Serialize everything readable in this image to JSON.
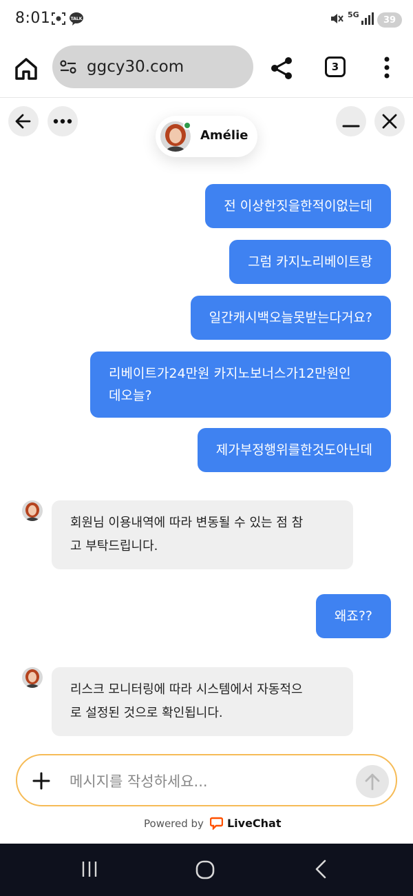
{
  "status_bar": {
    "time": "8:01",
    "network": "5G",
    "battery": "39"
  },
  "browser": {
    "url": "ggcy30.com",
    "tab_count": "3"
  },
  "chat": {
    "agent_name": "Amélie",
    "messages": [
      {
        "from": "user",
        "lines": [
          "전 이상한짓을한적이없는데"
        ]
      },
      {
        "from": "user",
        "lines": [
          "그럼 카지노리베이트랑"
        ]
      },
      {
        "from": "user",
        "lines": [
          "일간캐시백오늘못받는다거요?"
        ]
      },
      {
        "from": "user",
        "lines": [
          "리베이트가24만원 카지노보너스가12만원인",
          "데오늘?"
        ]
      },
      {
        "from": "user",
        "lines": [
          "제가부정행위를한것도아닌데"
        ]
      },
      {
        "from": "agent",
        "lines": [
          "회원님 이용내역에 따라 변동될 수 있는 점 참",
          "고 부탁드립니다."
        ]
      },
      {
        "from": "user",
        "lines": [
          "왜죠??"
        ]
      },
      {
        "from": "agent",
        "lines": [
          "리스크 모니터링에 따라 시스템에서 자동적으",
          "로 설정된 것으로 확인됩니다."
        ]
      }
    ],
    "composer_placeholder": "메시지를 작성하세요...",
    "powered_by": "Powered by",
    "brand": "LiveChat"
  },
  "colors": {
    "user_bubble": "#3f82f1",
    "agent_bubble": "#efefef",
    "composer_border": "#f6bb56",
    "online": "#2e9a4a",
    "livechat_orange": "#ff5100"
  }
}
